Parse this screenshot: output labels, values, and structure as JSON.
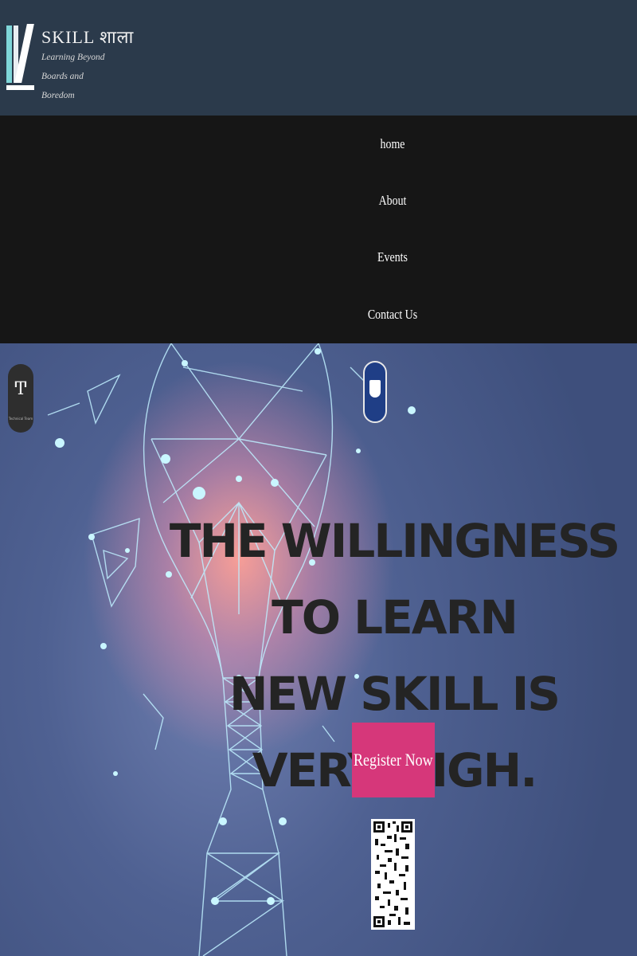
{
  "header": {
    "brand": "SKILL शाला",
    "tagline": "Learning Beyond Boards and Boredom"
  },
  "nav": {
    "items": [
      "home",
      "About",
      "Events",
      "Contact Us"
    ]
  },
  "hero": {
    "headline_line1": "THE WILLINGNESS TO LEARN",
    "headline_line2": "NEW SKILL IS VERY HIGH.",
    "register_label": "Register Now",
    "left_logo_label": "Technical Team",
    "colors": {
      "register_button": "#d6377a",
      "headline": "#242424",
      "nav_background": "#161616",
      "header_background": "#2b3a4b"
    }
  }
}
